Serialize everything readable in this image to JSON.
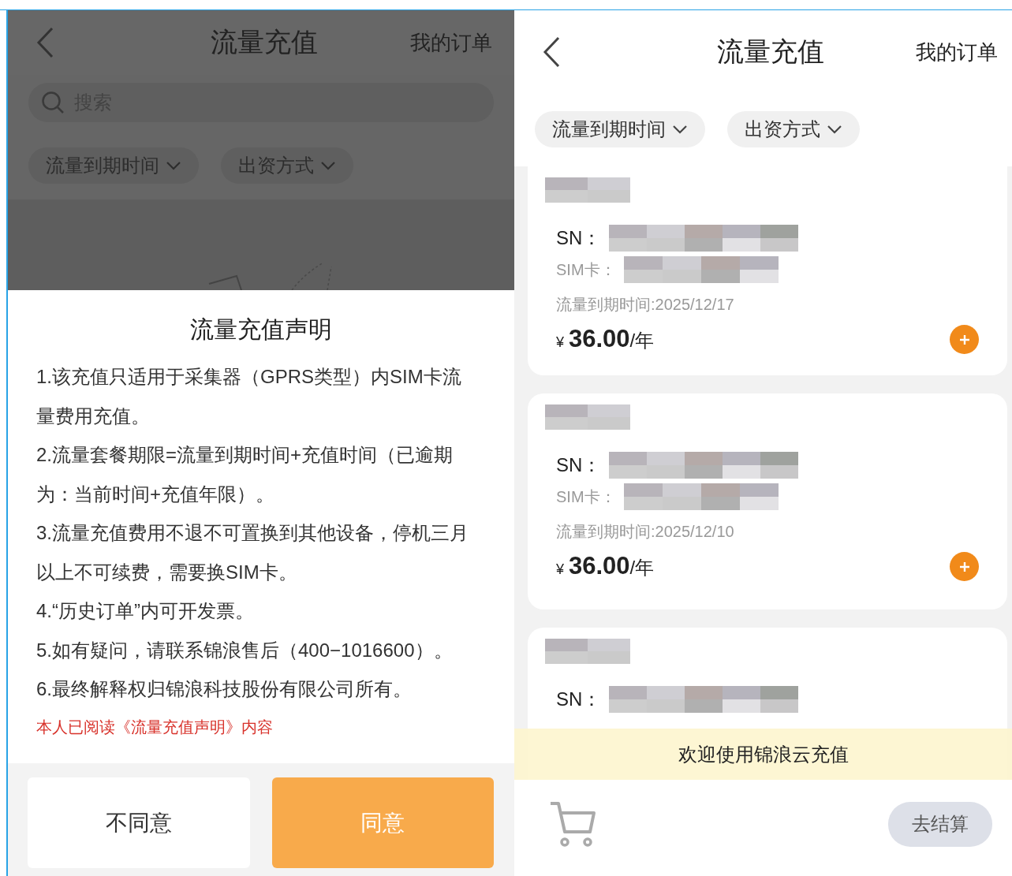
{
  "left_screen": {
    "header": {
      "title": "流量充值",
      "action": "我的订单"
    },
    "search": {
      "placeholder": "搜索"
    },
    "filters": [
      {
        "label": "流量到期时间"
      },
      {
        "label": "出资方式"
      }
    ],
    "dialog": {
      "title": "流量充值声明",
      "items": [
        "1.该充值只适用于采集器（GPRS类型）内SIM卡流量费用充值。",
        "2.流量套餐期限=流量到期时间+充值时间（已逾期为：当前时间+充值年限）。",
        "3.流量充值费用不退不可置换到其他设备，停机三月以上不可续费，需要换SIM卡。",
        "4.“历史订单”内可开发票。",
        "5.如有疑问，请联系锦浪售后（400−1016600）。",
        "6.最终解释权归锦浪科技股份有限公司所有。"
      ],
      "consent": "本人已阅读《流量充值声明》内容",
      "buttons": [
        {
          "label": "不同意",
          "kind": "secondary"
        },
        {
          "label": "同意",
          "kind": "primary"
        }
      ]
    }
  },
  "right_screen": {
    "header": {
      "title": "流量充值",
      "action": "我的订单"
    },
    "filters": [
      {
        "label": "流量到期时间"
      },
      {
        "label": "出资方式"
      }
    ],
    "devices": [
      {
        "sn_label": "SN：",
        "sim_label": "SIM卡：",
        "expiry": "流量到期时间:2025/12/17",
        "price": {
          "currency": "¥",
          "amount": "36.00",
          "unit": "/年"
        }
      },
      {
        "sn_label": "SN：",
        "sim_label": "SIM卡：",
        "expiry": "流量到期时间:2025/12/10",
        "price": {
          "currency": "¥",
          "amount": "36.00",
          "unit": "/年"
        }
      },
      {
        "sn_label": "SN："
      }
    ],
    "toast": "欢迎使用锦浪云充值",
    "checkout": "去结算"
  }
}
